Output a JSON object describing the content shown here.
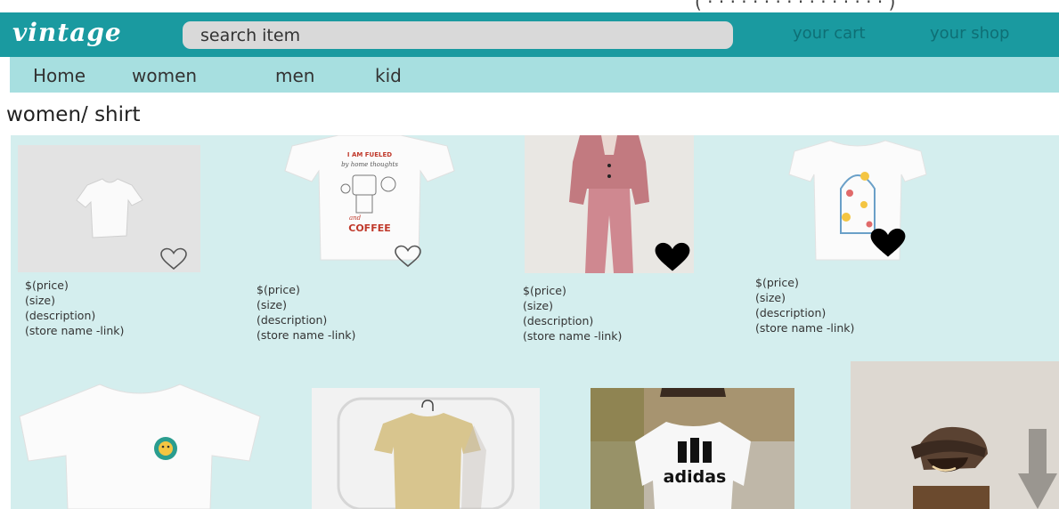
{
  "header": {
    "logo": "vintage",
    "search_placeholder": "search item",
    "cart_label": "your cart",
    "shop_label": "your shop"
  },
  "menu": [
    "Home",
    "women",
    "men",
    "kid"
  ],
  "breadcrumb": "women/ shirt",
  "products": [
    {
      "price": "$(price)",
      "size": "(size)",
      "description": "(description)",
      "store": "(store name -link)",
      "favorited": false
    },
    {
      "price": "$(price)",
      "size": "(size)",
      "description": "(description)",
      "store": "(store name -link)",
      "favorited": false
    },
    {
      "price": "$(price)",
      "size": "(size)",
      "description": "(description)",
      "store": "(store name -link)",
      "favorited": true
    },
    {
      "price": "$(price)",
      "size": "(size)",
      "description": "(description)",
      "store": "(store name -link)",
      "favorited": true
    }
  ],
  "shirt_print": {
    "line1": "I AM FUELED",
    "line2": "by home thoughts",
    "line3": "and",
    "line4": "COFFEE"
  },
  "brand_print": "adidas",
  "colors": {
    "header": "#1a9aa0",
    "menu": "#a7dfe0",
    "content": "#d4eeee"
  }
}
